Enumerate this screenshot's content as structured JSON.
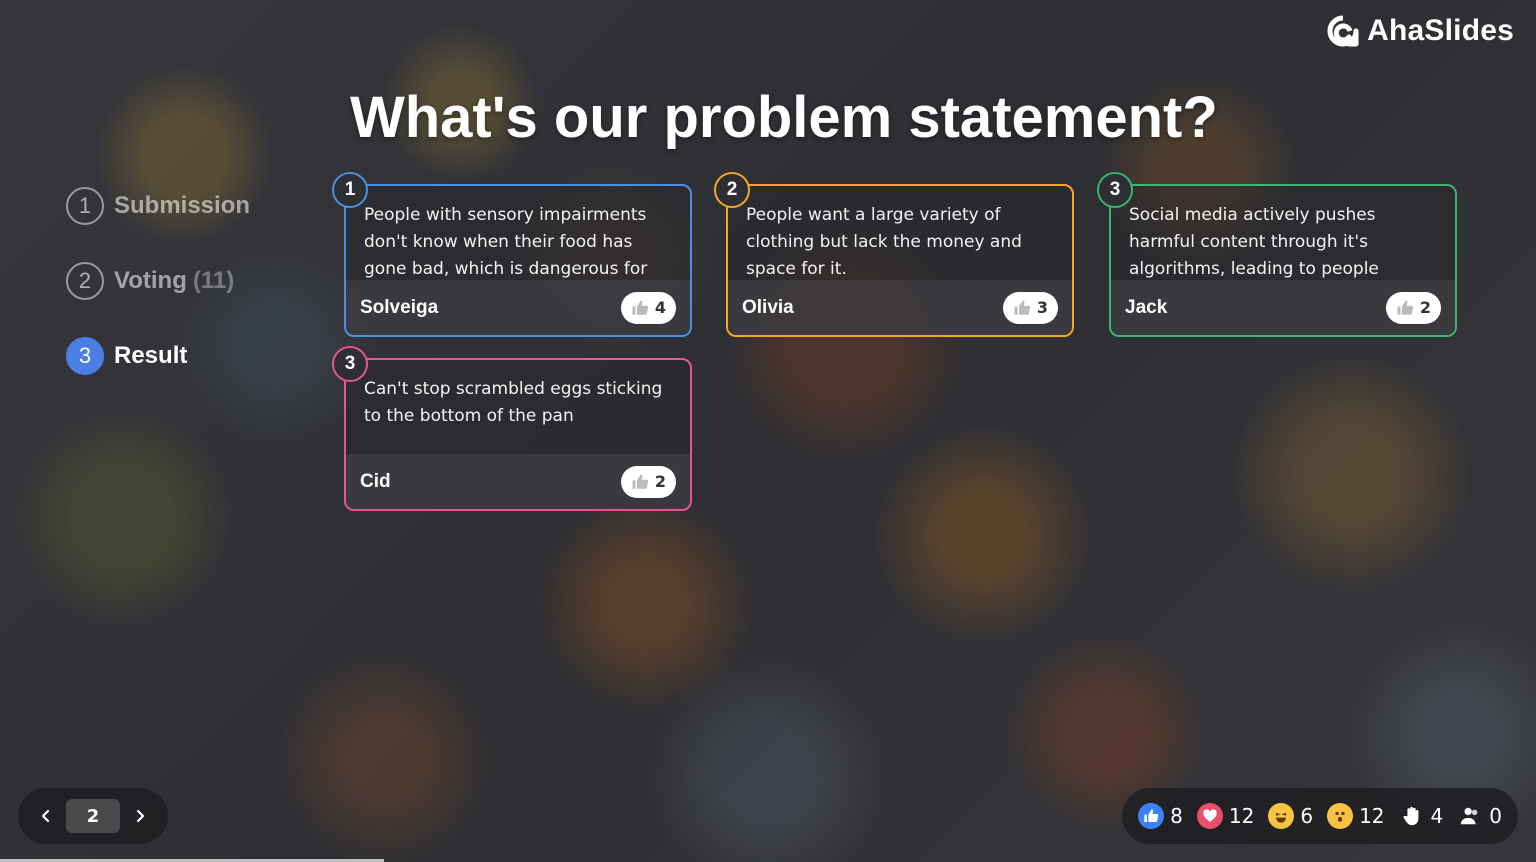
{
  "brand": {
    "name": "AhaSlides"
  },
  "slide": {
    "title": "What's our problem statement?"
  },
  "steps": [
    {
      "num": "1",
      "label": "Submission",
      "count": ""
    },
    {
      "num": "2",
      "label": "Voting",
      "count": "(11)"
    },
    {
      "num": "3",
      "label": "Result",
      "count": ""
    }
  ],
  "cards": [
    {
      "rank": "1",
      "text": "People with sensory impairments don't know when their food has gone bad, which is dangerous for",
      "author": "Solveiga",
      "likes": "4",
      "color": "#4a90e2"
    },
    {
      "rank": "2",
      "text": "People want a large variety of clothing but lack the money and space for it.",
      "author": "Olivia",
      "likes": "3",
      "color": "#f5a623"
    },
    {
      "rank": "3",
      "text": "Social media actively pushes harmful content through it's algorithms, leading to people",
      "author": "Jack",
      "likes": "2",
      "color": "#3cb371"
    },
    {
      "rank": "3",
      "text": "Can't stop scrambled eggs sticking to the bottom of the pan",
      "author": "Cid",
      "likes": "2",
      "color": "#e8578a"
    }
  ],
  "pager": {
    "current": "2"
  },
  "reactions": {
    "like": "8",
    "heart": "12",
    "laugh": "6",
    "wow": "12",
    "hand": "4",
    "audience": "0"
  },
  "colors": {
    "accent": "#4c7fe6"
  }
}
